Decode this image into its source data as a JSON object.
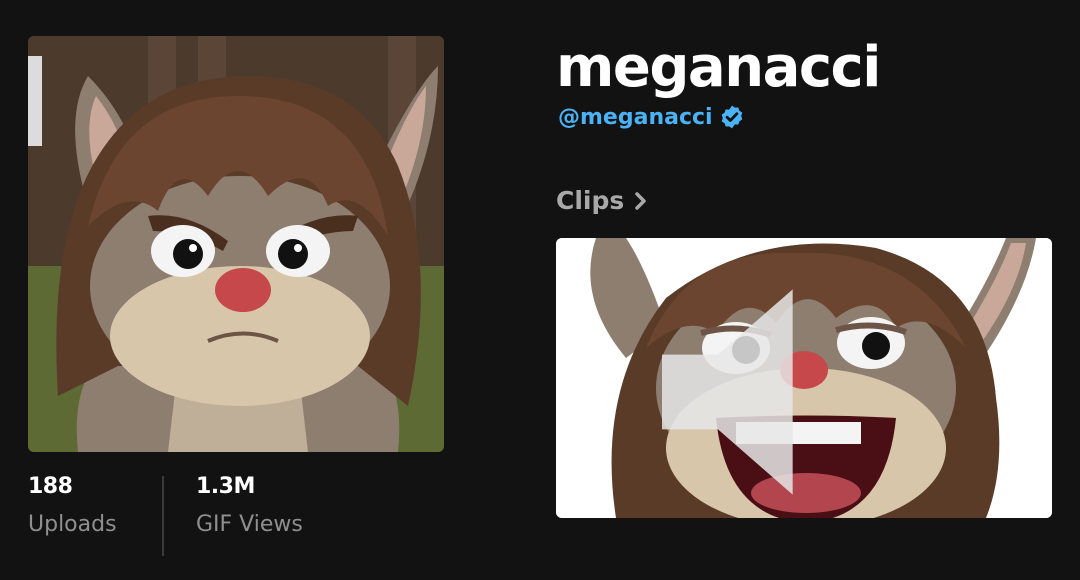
{
  "profile": {
    "name": "meganacci",
    "handle": "@meganacci",
    "verified": true
  },
  "stats": {
    "uploads": {
      "value": "188",
      "label": "Uploads"
    },
    "views": {
      "value": "1.3M",
      "label": "GIF Views"
    }
  },
  "clips": {
    "label": "Clips"
  },
  "icons": {
    "verified": "verified-badge-icon",
    "chevron": "chevron-right-icon",
    "mute": "speaker-muted-icon"
  },
  "colors": {
    "background": "#121212",
    "handle": "#4ab2f5",
    "muted_text": "#8f8f8f"
  }
}
